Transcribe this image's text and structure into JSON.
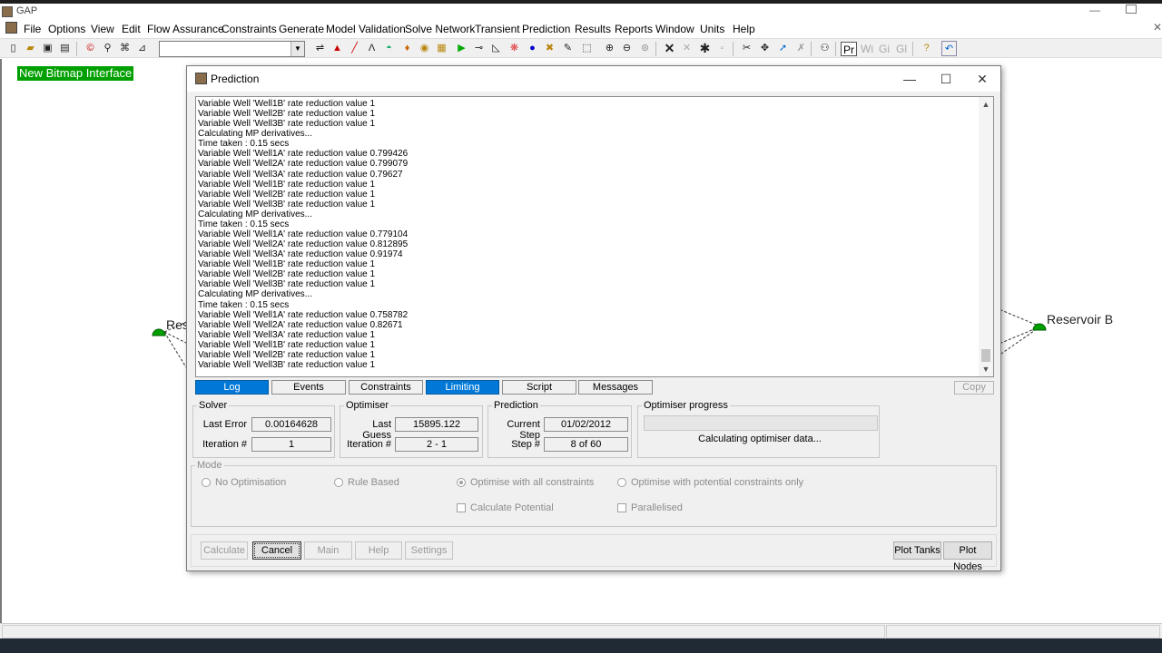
{
  "app": {
    "title": "GAP"
  },
  "menu": [
    "File",
    "Options",
    "View",
    "Edit",
    "Flow Assurance",
    "Constraints",
    "Generate",
    "Model Validation",
    "Solve Network",
    "Transient",
    "Prediction",
    "Results",
    "Reports",
    "Window",
    "Units",
    "Help"
  ],
  "toolbar": {
    "combo_value": "",
    "text_buttons": [
      "Pr",
      "Wi",
      "Gi",
      "Gl"
    ]
  },
  "canvas": {
    "bitmap_label": "New Bitmap Interface",
    "reservoir_left_label": "Res",
    "reservoir_right_label": "Reservoir B"
  },
  "dialog": {
    "title": "Prediction",
    "log_lines": [
      "Variable Well 'Well1B' rate reduction value 1",
      "Variable Well 'Well2B' rate reduction value 1",
      "Variable Well 'Well3B' rate reduction value 1",
      "Calculating MP derivatives...",
      "Time taken : 0.15 secs",
      "Variable Well 'Well1A' rate reduction value 0.799426",
      "Variable Well 'Well2A' rate reduction value 0.799079",
      "Variable Well 'Well3A' rate reduction value 0.79627",
      "Variable Well 'Well1B' rate reduction value 1",
      "Variable Well 'Well2B' rate reduction value 1",
      "Variable Well 'Well3B' rate reduction value 1",
      "Calculating MP derivatives...",
      "Time taken : 0.15 secs",
      "Variable Well 'Well1A' rate reduction value 0.779104",
      "Variable Well 'Well2A' rate reduction value 0.812895",
      "Variable Well 'Well3A' rate reduction value 0.91974",
      "Variable Well 'Well1B' rate reduction value 1",
      "Variable Well 'Well2B' rate reduction value 1",
      "Variable Well 'Well3B' rate reduction value 1",
      "Calculating MP derivatives...",
      "Time taken : 0.15 secs",
      "Variable Well 'Well1A' rate reduction value 0.758782",
      "Variable Well 'Well2A' rate reduction value 0.82671",
      "Variable Well 'Well3A' rate reduction value 1",
      "Variable Well 'Well1B' rate reduction value 1",
      "Variable Well 'Well2B' rate reduction value 1",
      "Variable Well 'Well3B' rate reduction value 1"
    ],
    "tabs": [
      {
        "label": "Log",
        "active": true
      },
      {
        "label": "Events",
        "active": false
      },
      {
        "label": "Constraints",
        "active": false
      },
      {
        "label": "Limiting",
        "active": true
      },
      {
        "label": "Script",
        "active": false
      },
      {
        "label": "Messages",
        "active": false
      }
    ],
    "copy_label": "Copy",
    "solver": {
      "title": "Solver",
      "last_error_label": "Last Error",
      "last_error": "0.00164628",
      "iteration_label": "Iteration #",
      "iteration": "1"
    },
    "optimiser": {
      "title": "Optimiser",
      "last_guess_label": "Last Guess",
      "last_guess": "15895.122",
      "iteration_label": "Iteration #",
      "iteration": "2 - 1"
    },
    "prediction": {
      "title": "Prediction",
      "current_step_label": "Current Step",
      "current_step": "01/02/2012",
      "step_label": "Step #",
      "step": "8 of 60"
    },
    "optimiser_progress": {
      "title": "Optimiser progress",
      "fraction": 0,
      "status": "Calculating optimiser data..."
    },
    "mode": {
      "title": "Mode",
      "no_optimisation": "No Optimisation",
      "rule_based": "Rule Based",
      "optimise_all": "Optimise with all constraints",
      "optimise_potential": "Optimise with potential constraints only",
      "selected": "optimise_all",
      "calculate_potential": "Calculate Potential",
      "parallelised": "Parallelised"
    },
    "buttons": {
      "calculate": "Calculate",
      "cancel": "Cancel",
      "main": "Main",
      "help": "Help",
      "settings": "Settings",
      "plot_tanks": "Plot Tanks",
      "plot_nodes": "Plot Nodes"
    }
  },
  "colors": {
    "accent": "#0078d7",
    "bitmap_label_bg": "#00a000",
    "reservoir_node": "#00a000"
  }
}
